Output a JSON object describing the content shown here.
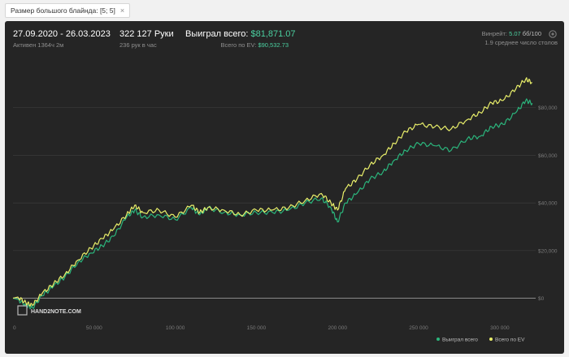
{
  "filter": {
    "label": "Размер большого блайнда: [5; 5]",
    "close": "×"
  },
  "header": {
    "date_range": "27.09.2020 - 26.03.2023",
    "active": "Активен 1364ч 2м",
    "hands": "322 127 Руки",
    "hands_per_hour": "236 рук в час",
    "won_label": "Выиграл всего:",
    "won_value": "$81,871.07",
    "ev_label": "Всего по EV:",
    "ev_value": "$90,532.73",
    "winrate_label": "Винрейт:",
    "winrate_value": "5.07",
    "winrate_unit": "бб/100",
    "avg_tables": "1.9 среднее число столов"
  },
  "logo": {
    "text": "HAND2NOTE.COM"
  },
  "colors": {
    "won": "#2bb57c",
    "ev": "#e9ef6a",
    "grid": "#3a3a3a",
    "zero": "#8a8a8a"
  },
  "chart_data": {
    "type": "line",
    "xlim": [
      0,
      322127
    ],
    "ylim": [
      -8000,
      100000
    ],
    "x_ticks": [
      0,
      50000,
      100000,
      150000,
      200000,
      250000,
      300000
    ],
    "x_tick_labels": [
      "0",
      "50 000",
      "100 000",
      "150 000",
      "200 000",
      "250 000",
      "300 000"
    ],
    "y_ticks": [
      0,
      20000,
      40000,
      60000,
      80000
    ],
    "y_tick_labels": [
      "$0",
      "$20,000",
      "$40,000",
      "$60,000",
      "$80,000"
    ],
    "grid": true,
    "legend": "bottom-right",
    "x": [
      0,
      3000,
      8000,
      12000,
      18000,
      25000,
      32000,
      40000,
      48000,
      55000,
      62000,
      70000,
      75000,
      80000,
      90000,
      100000,
      110000,
      115000,
      120000,
      130000,
      140000,
      150000,
      160000,
      170000,
      180000,
      190000,
      196000,
      200000,
      205000,
      212000,
      220000,
      228000,
      235000,
      242000,
      250000,
      260000,
      270000,
      280000,
      288000,
      295000,
      302000,
      310000,
      316000,
      320000
    ],
    "series": [
      {
        "name": "Выиграл всего",
        "values": [
          0,
          -500,
          -3000,
          -4000,
          1000,
          5000,
          9000,
          15000,
          19000,
          22000,
          26000,
          34000,
          37000,
          34000,
          35000,
          33000,
          38000,
          35000,
          38000,
          36000,
          35000,
          36000,
          36000,
          37000,
          40000,
          42000,
          38000,
          32000,
          40000,
          44000,
          50000,
          53000,
          58000,
          62000,
          65000,
          64000,
          62000,
          67000,
          68000,
          72000,
          73000,
          78000,
          83000,
          81871
        ]
      },
      {
        "name": "Всего по EV",
        "values": [
          0,
          500,
          -2000,
          -3000,
          2000,
          6000,
          10000,
          16000,
          21000,
          25000,
          29000,
          35000,
          39000,
          36000,
          37000,
          34000,
          39000,
          36000,
          38000,
          37000,
          35000,
          37000,
          37000,
          38000,
          41000,
          44000,
          40000,
          37000,
          46000,
          50000,
          56000,
          60000,
          65000,
          70000,
          73000,
          72000,
          71000,
          75000,
          78000,
          82000,
          83000,
          88000,
          92000,
          90533
        ]
      }
    ]
  }
}
